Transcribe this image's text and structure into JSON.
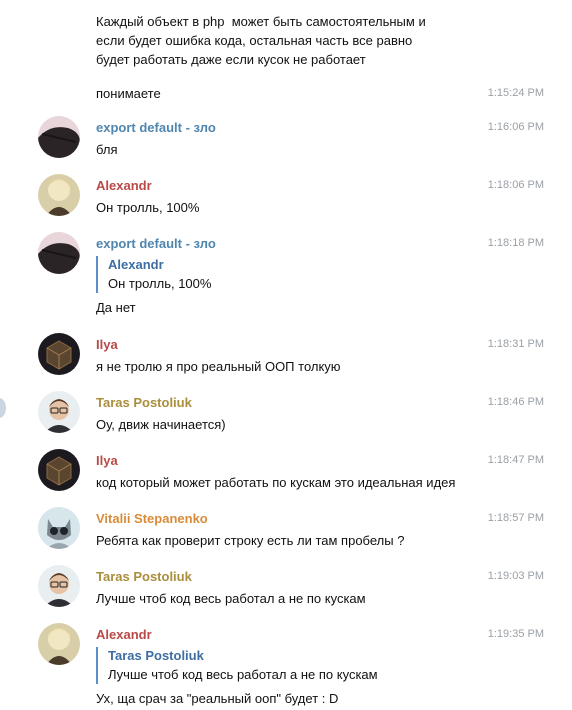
{
  "messages": [
    {
      "text": "Каждый объект в php  может быть самостоятельным и\nесли будет ошибка кода, остальная часть все равно\nбудет работать даже если кусок не работает"
    },
    {
      "text": "понимаете",
      "time": "1:15:24 PM"
    },
    {
      "author": "export default - зло",
      "color": "#4f86b0",
      "time": "1:16:06 PM",
      "text": "бля",
      "avatar": "dark-hair-avatar"
    },
    {
      "author": "Alexandr",
      "color": "#b94a48",
      "time": "1:18:06 PM",
      "text": "Он тролль, 100%",
      "avatar": "anime-girl-avatar"
    },
    {
      "author": "export default - зло",
      "color": "#4f86b0",
      "time": "1:18:18 PM",
      "avatar": "dark-hair-avatar",
      "reply": {
        "author": "Alexandr",
        "text": "Он тролль, 100%"
      },
      "text": "Да нет"
    },
    {
      "author": "Ilya",
      "color": "#b94a48",
      "time": "1:18:31 PM",
      "text": "я не тролю я про реальный ООП толкую",
      "avatar": "cube-avatar"
    },
    {
      "author": "Taras Postoliuk",
      "color": "#a98e3c",
      "time": "1:18:46 PM",
      "text": "Оу, движ начинается)",
      "avatar": "glasses-man-avatar"
    },
    {
      "author": "Ilya",
      "color": "#b94a48",
      "time": "1:18:47 PM",
      "text": "код который может работать по кускам это идеальная идея",
      "avatar": "cube-avatar"
    },
    {
      "author": "Vitalii Stepanenko",
      "color": "#d98b3a",
      "time": "1:18:57 PM",
      "text": "Ребята как проверит строку есть ли там пробелы ?",
      "avatar": "cat-avatar"
    },
    {
      "author": "Taras Postoliuk",
      "color": "#a98e3c",
      "time": "1:19:03 PM",
      "text": "Лучше чтоб код весь работал а не по кускам",
      "avatar": "glasses-man-avatar"
    },
    {
      "author": "Alexandr",
      "color": "#b94a48",
      "time": "1:19:35 PM",
      "avatar": "anime-girl-avatar",
      "reply": {
        "author": "Taras Postoliuk",
        "text": "Лучше чтоб код весь работал а не по кускам"
      },
      "text": "Ух, ща срач за \"реальный ооп\" будет : D"
    }
  ]
}
